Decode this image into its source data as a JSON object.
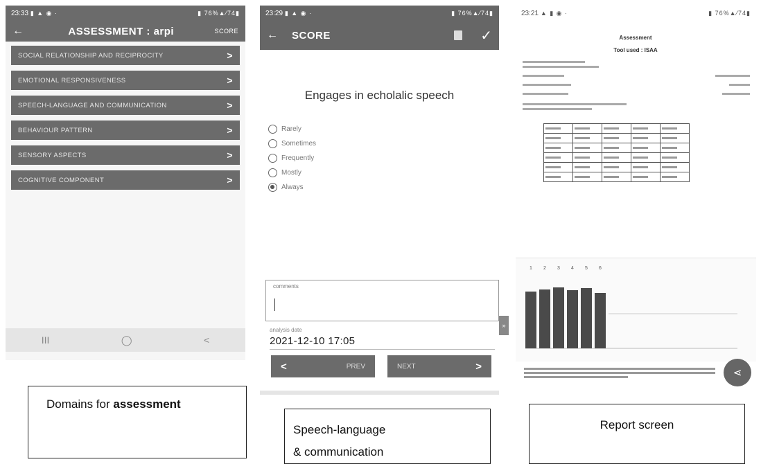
{
  "phone1": {
    "status_time": "23:33",
    "status_icons": "▮ ▲ ◉ ·",
    "status_right": "▮ 76%▲⁄74▮",
    "title": "ASSESSMENT : arpi",
    "score_label": "SCORE",
    "domains": [
      "SOCIAL RELATIONSHIP AND RECIPROCITY",
      "EMOTIONAL RESPONSIVENESS",
      "SPEECH-LANGUAGE AND COMMUNICATION",
      "BEHAVIOUR PATTERN",
      "SENSORY ASPECTS",
      "COGNITIVE COMPONENT"
    ]
  },
  "phone2": {
    "status_time": "23:29",
    "status_icons": "▮ ▲ ◉ ·",
    "status_right": "▮ 76%▲⁄74▮",
    "title": "SCORE",
    "question": "Engages in echolalic speech",
    "options": [
      "Rarely",
      "Sometimes",
      "Frequently",
      "Mostly",
      "Always"
    ],
    "selected_option": "Always",
    "comments_label": "comments",
    "analysis_label": "analysis date",
    "analysis_date": "2021-12-10 17:05",
    "prev_label": "PREV",
    "next_label": "NEXT"
  },
  "phone3": {
    "status_time": "23:21",
    "status_icons": "▲ ▮ ◉ ·",
    "status_right": "▮ 76%▲⁄74▮",
    "report_heading": "Assessment",
    "report_subheading": "Tool used : ISAA",
    "chart_data": {
      "type": "bar",
      "categories": [
        "1",
        "2",
        "3",
        "4",
        "5",
        "6"
      ],
      "values": [
        82,
        85,
        88,
        84,
        87,
        80
      ],
      "ylim": [
        0,
        100
      ]
    }
  },
  "nav": {
    "recent": "III",
    "home": "◯",
    "back": "<"
  },
  "captions": {
    "cap1_normal": "Domains for ",
    "cap1_bold": "assessment",
    "cap2_line1": "Speech-language",
    "cap2_line2": "& communication",
    "cap3": "Report screen"
  }
}
